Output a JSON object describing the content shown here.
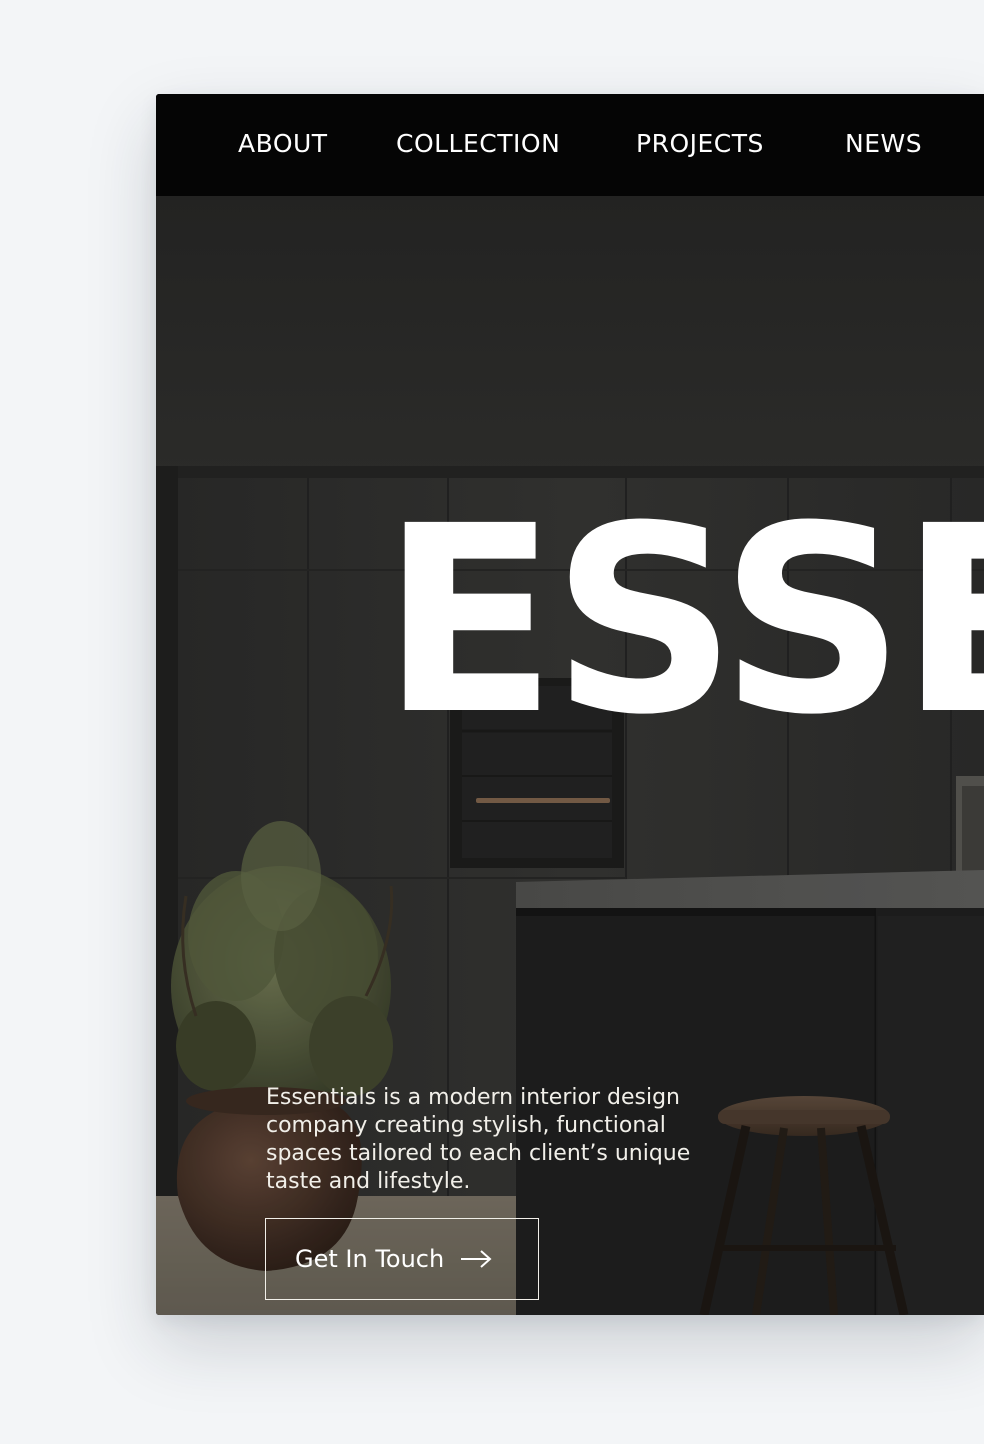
{
  "nav": {
    "items": [
      "ABOUT",
      "COLLECTION",
      "PROJECTS",
      "NEWS"
    ]
  },
  "hero": {
    "title": "ESSE",
    "description": "Essentials is a modern interior design company creating stylish, functional spaces tailored to each client’s unique taste and lifestyle.",
    "cta_label": "Get In Touch",
    "cta_icon": "arrow-right-icon"
  },
  "colors": {
    "nav_background": "#050505",
    "text": "#ffffff",
    "page_background": "#f3f5f7"
  }
}
